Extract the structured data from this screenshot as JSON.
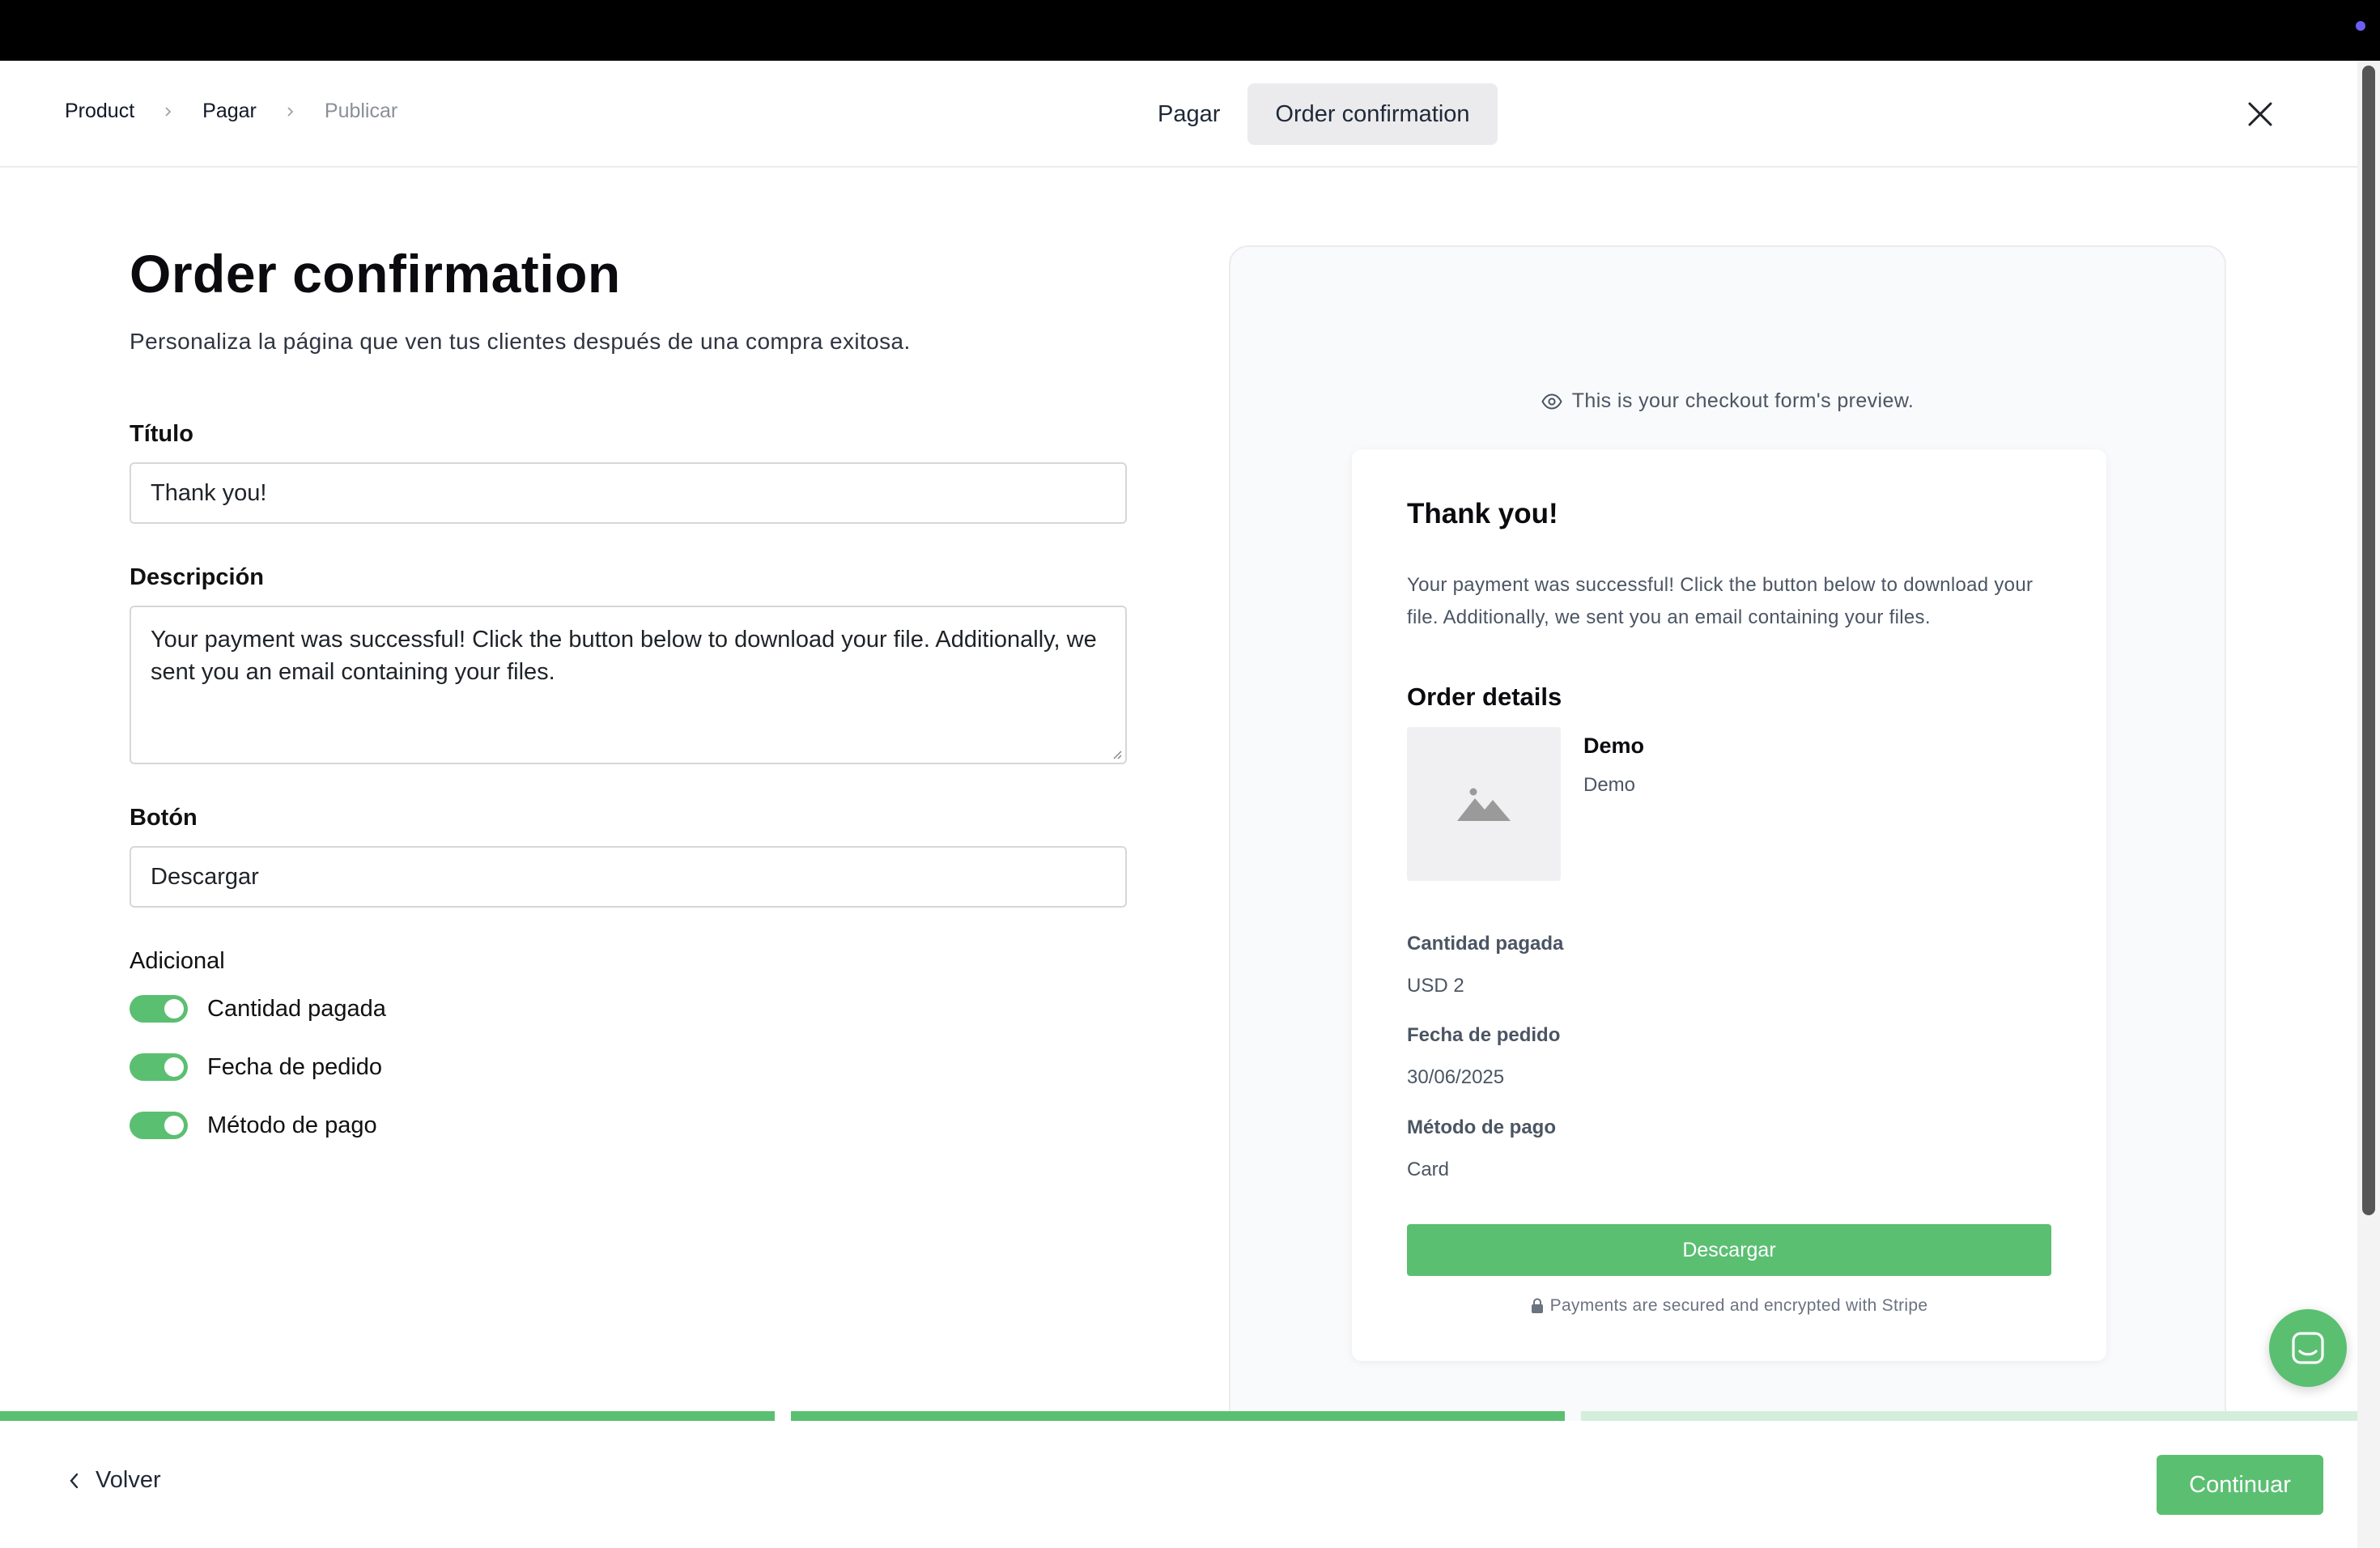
{
  "breadcrumb": {
    "items": [
      "Product",
      "Pagar",
      "Publicar"
    ]
  },
  "steps": {
    "tabs": [
      "Pagar",
      "Order confirmation"
    ],
    "active": 1
  },
  "form": {
    "title": "Order confirmation",
    "subtitle": "Personaliza la página que ven tus clientes después de una compra exitosa.",
    "title_field": {
      "label": "Título",
      "value": "Thank you!"
    },
    "description_field": {
      "label": "Descripción",
      "value": "Your payment was successful! Click the button below to download your file. Additionally, we sent you an email containing your files."
    },
    "button_field": {
      "label": "Botón",
      "value": "Descargar"
    },
    "additional": {
      "label": "Adicional",
      "toggles": [
        {
          "label": "Cantidad pagada",
          "on": true
        },
        {
          "label": "Fecha de pedido",
          "on": true
        },
        {
          "label": "Método de pago",
          "on": true
        }
      ]
    }
  },
  "preview": {
    "note": "This is your checkout form's preview.",
    "card": {
      "title": "Thank you!",
      "description": "Your payment was successful! Click the button below to download your file. Additionally, we sent you an email containing your files.",
      "order_details_heading": "Order details",
      "product_name": "Demo",
      "product_desc": "Demo",
      "amount_label": "Cantidad pagada",
      "amount_value": "USD 2",
      "date_label": "Fecha de pedido",
      "date_value": "30/06/2025",
      "method_label": "Método de pago",
      "method_value": "Card",
      "button_label": "Descargar",
      "secure_note": "Payments are secured and encrypted with Stripe"
    }
  },
  "progress": {
    "segments_complete": 2,
    "segments_total": 3
  },
  "footer": {
    "back_label": "Volver",
    "continue_label": "Continuar"
  },
  "colors": {
    "accent": "#5bbf72",
    "accent_light": "#d3eedb",
    "muted": "#8b8f97"
  }
}
